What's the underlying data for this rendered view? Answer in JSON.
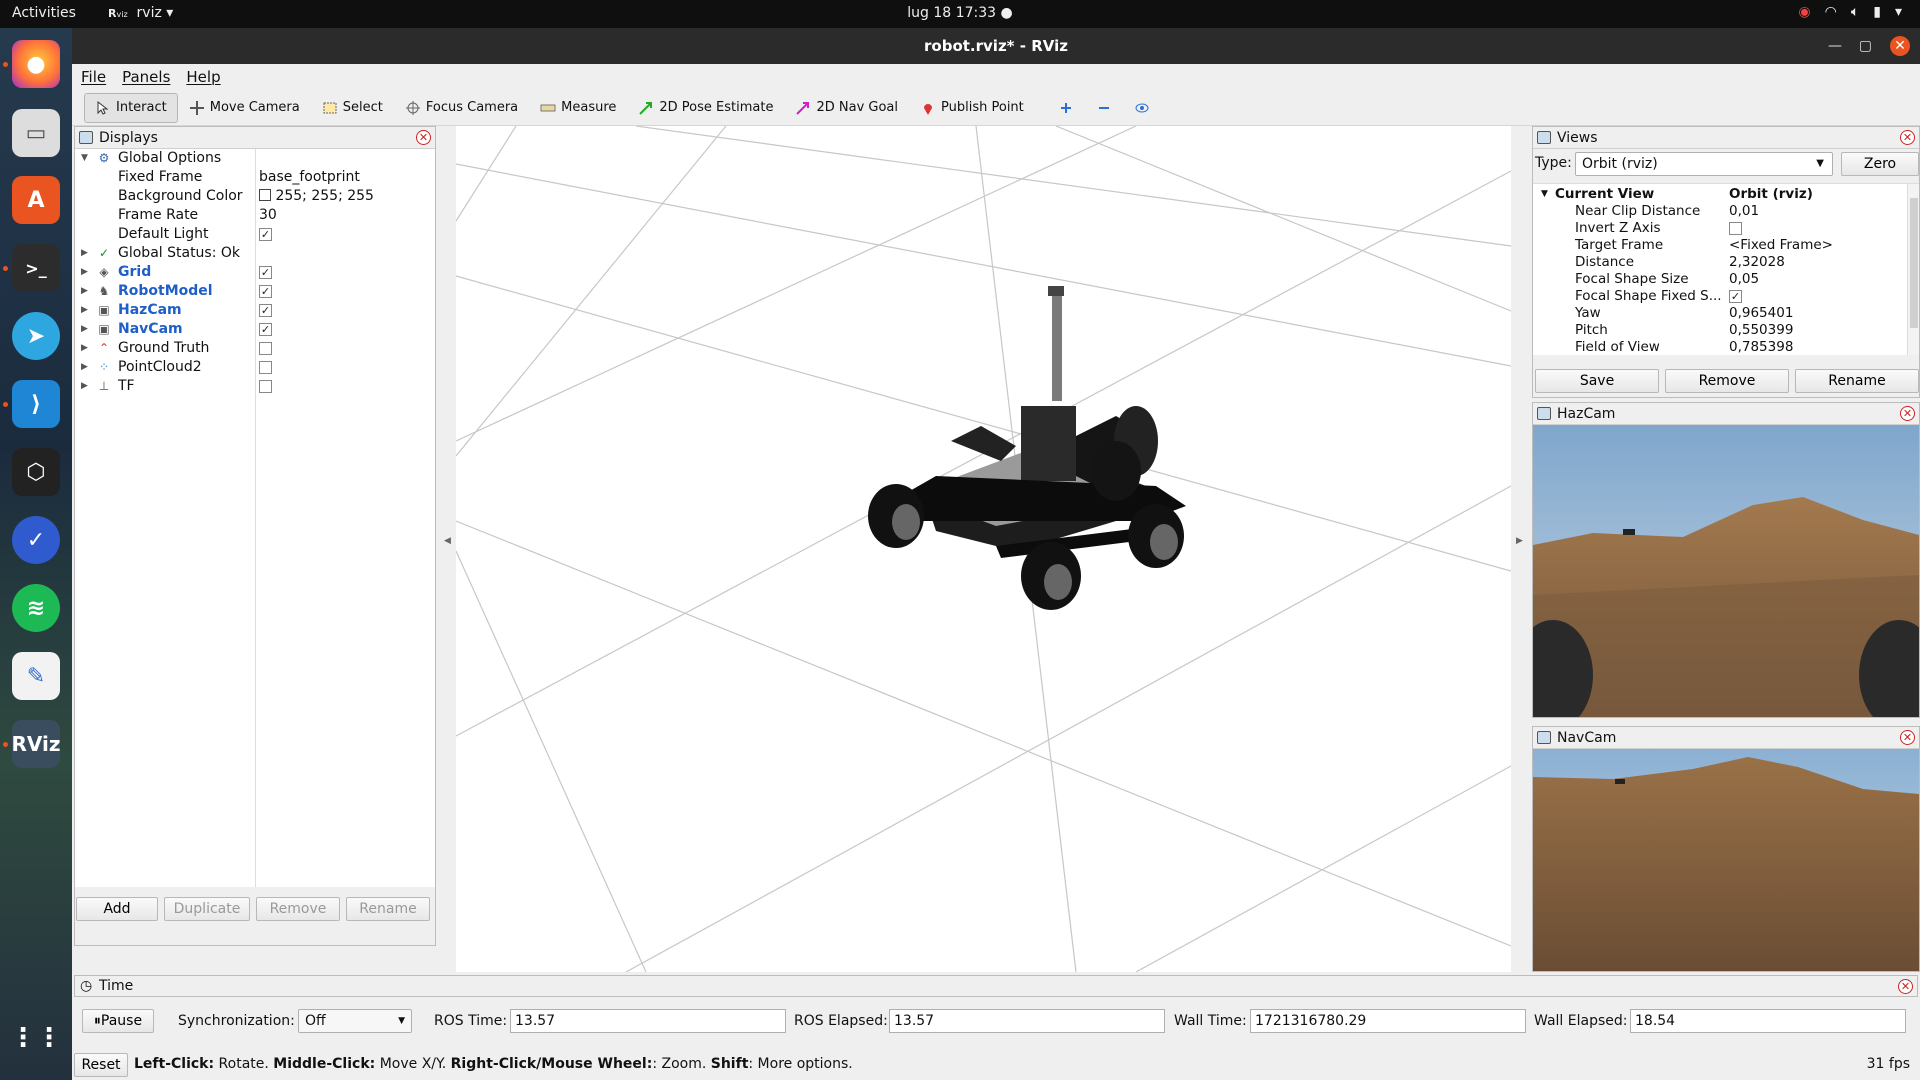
{
  "topbar": {
    "activities": "Activities",
    "app_name": "rviz",
    "clock": "lug 18  17:33"
  },
  "dock": {
    "items": [
      "firefox-icon",
      "files-icon",
      "app-center-icon",
      "terminal-icon",
      "telegram-icon",
      "vscode-icon",
      "stacks-icon",
      "tasks-icon",
      "spotify-icon",
      "text-editor-icon",
      "rviz-icon",
      "show-apps-icon"
    ]
  },
  "window": {
    "title": "robot.rviz* - RViz"
  },
  "menu": {
    "file": "File",
    "panels": "Panels",
    "help": "Help"
  },
  "toolbar": {
    "interact": "Interact",
    "move_camera": "Move Camera",
    "select": "Select",
    "focus_camera": "Focus Camera",
    "measure": "Measure",
    "pose_estimate": "2D Pose Estimate",
    "nav_goal": "2D Nav Goal",
    "publish_point": "Publish Point"
  },
  "displays": {
    "title": "Displays",
    "global_options": "Global Options",
    "fixed_frame_label": "Fixed Frame",
    "fixed_frame_value": "base_footprint",
    "bg_color_label": "Background Color",
    "bg_color_value": "255; 255; 255",
    "frame_rate_label": "Frame Rate",
    "frame_rate_value": "30",
    "default_light_label": "Default Light",
    "global_status": "Global Status: Ok",
    "items": [
      "Grid",
      "RobotModel",
      "HazCam",
      "NavCam",
      "Ground Truth",
      "PointCloud2",
      "TF"
    ],
    "add": "Add",
    "duplicate": "Duplicate",
    "remove": "Remove",
    "rename": "Rename"
  },
  "views": {
    "title": "Views",
    "type_label": "Type:",
    "type_value": "Orbit (rviz)",
    "zero": "Zero",
    "current_view": "Current View",
    "current_view_value": "Orbit (rviz)",
    "props": [
      {
        "k": "Near Clip Distance",
        "v": "0,01"
      },
      {
        "k": "Invert Z Axis",
        "v": ""
      },
      {
        "k": "Target Frame",
        "v": "<Fixed Frame>"
      },
      {
        "k": "Distance",
        "v": "2,32028"
      },
      {
        "k": "Focal Shape Size",
        "v": "0,05"
      },
      {
        "k": "Focal Shape Fixed S...",
        "v": ""
      },
      {
        "k": "Yaw",
        "v": "0,965401"
      },
      {
        "k": "Pitch",
        "v": "0,550399"
      },
      {
        "k": "Field of View",
        "v": "0,785398"
      }
    ],
    "save": "Save",
    "remove": "Remove",
    "rename": "Rename"
  },
  "hazcam": {
    "title": "HazCam"
  },
  "navcam": {
    "title": "NavCam"
  },
  "time": {
    "title": "Time",
    "pause": "Pause",
    "sync_label": "Synchronization:",
    "sync_value": "Off",
    "ros_time_label": "ROS Time:",
    "ros_time": "13.57",
    "ros_elapsed_label": "ROS Elapsed:",
    "ros_elapsed": "13.57",
    "wall_time_label": "Wall Time:",
    "wall_time": "1721316780.29",
    "wall_elapsed_label": "Wall Elapsed:",
    "wall_elapsed": "18.54"
  },
  "status": {
    "reset": "Reset",
    "b1": "Left-Click:",
    "t1": " Rotate. ",
    "b2": "Middle-Click:",
    "t2": " Move X/Y. ",
    "b3": "Right-Click/Mouse Wheel:",
    "t3": ": Zoom. ",
    "b4": "Shift",
    "t4": ": More options.",
    "fps": "31 fps"
  }
}
